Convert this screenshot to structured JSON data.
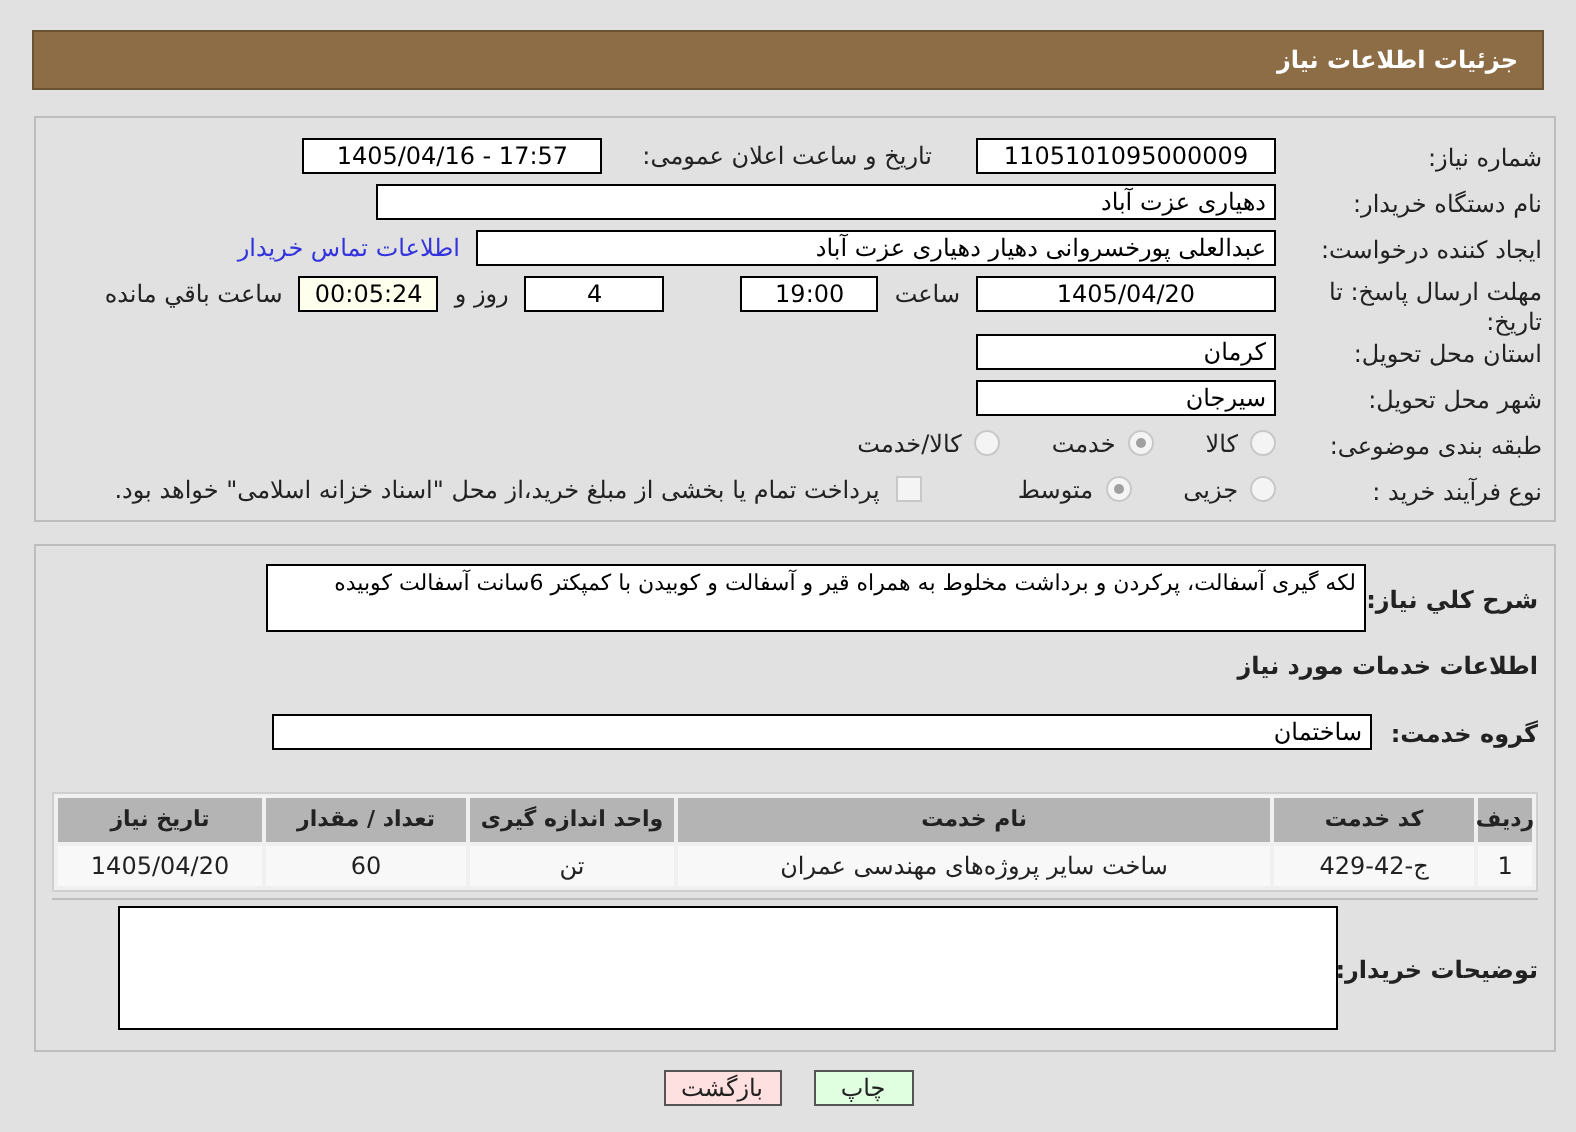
{
  "header": {
    "title": "جزئیات اطلاعات نیاز"
  },
  "details": {
    "need_number": {
      "label": "شماره نیاز:",
      "value": "1105101095000009"
    },
    "announce": {
      "label": "تاریخ و ساعت اعلان عمومی:",
      "value": "1405/04/16 - 17:57"
    },
    "buyer_org": {
      "label": "نام دستگاه خریدار:",
      "value": "دهیاری عزت آباد"
    },
    "requester": {
      "label": "ایجاد کننده درخواست:",
      "value": "عبدالعلی پورخسروانی دهیار دهیاری عزت آباد",
      "link": "اطلاعات تماس خریدار"
    },
    "deadline": {
      "label": "مهلت ارسال پاسخ: تا تاریخ:",
      "date": "1405/04/20",
      "time_label": "ساعت",
      "time": "19:00",
      "days": "4",
      "days_label": "روز و",
      "remaining": "00:05:24",
      "remaining_label": "ساعت باقي مانده"
    },
    "province": {
      "label": "استان محل تحویل:",
      "value": "کرمان"
    },
    "city": {
      "label": "شهر محل تحویل:",
      "value": "سیرجان"
    },
    "category": {
      "label": "طبقه بندی موضوعی:",
      "options": [
        {
          "label": "کالا",
          "selected": false
        },
        {
          "label": "خدمت",
          "selected": true
        },
        {
          "label": "کالا/خدمت",
          "selected": false
        }
      ]
    },
    "process": {
      "label": "نوع فرآیند خرید :",
      "options": [
        {
          "label": "جزیی",
          "selected": false
        },
        {
          "label": "متوسط",
          "selected": true
        }
      ],
      "payment": {
        "checked": false,
        "text": "پرداخت تمام یا بخشی از مبلغ خرید،از محل \"اسناد خزانه اسلامی\" خواهد بود."
      }
    }
  },
  "description": {
    "label": "شرح كلي نياز:",
    "value": "لکه گیری آسفالت، پرکردن و برداشت مخلوط به همراه قیر و آسفالت و کوبیدن با کمپکتر 6سانت آسفالت کوبیده"
  },
  "services_title": "اطلاعات خدمات مورد نياز",
  "service_group": {
    "label": "گروه خدمت:",
    "value": "ساختمان"
  },
  "table": {
    "columns": [
      "ردیف",
      "کد خدمت",
      "نام خدمت",
      "واحد اندازه گیری",
      "تعداد / مقدار",
      "تاریخ نیاز"
    ],
    "rows": [
      [
        "1",
        "ج-42-429",
        "ساخت سایر پروژه‌های مهندسی عمران",
        "تن",
        "60",
        "1405/04/20"
      ]
    ]
  },
  "buyer_notes": {
    "label": "توضیحات خریدار:"
  },
  "buttons": [
    {
      "label": "چاپ",
      "kind": "print"
    },
    {
      "label": "بازگشت",
      "kind": "back"
    }
  ]
}
